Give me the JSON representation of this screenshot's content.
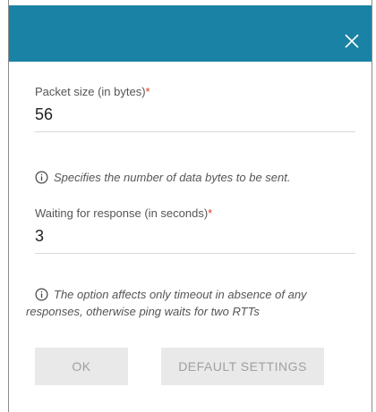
{
  "dialog": {
    "header_color": "#1a82a4",
    "close_icon": "close-icon"
  },
  "fields": {
    "packet_size": {
      "label": "Packet size (in bytes)",
      "required_mark": "*",
      "value": "56",
      "hint": "Specifies the number of data bytes to be sent."
    },
    "waiting": {
      "label": "Waiting for response (in seconds)",
      "required_mark": "*",
      "value": "3",
      "hint_line1": "The option affects only timeout in absence of any",
      "hint_line2": "responses, otherwise ping waits for two RTTs"
    }
  },
  "buttons": {
    "ok_label": "OK",
    "default_settings_label": "DEFAULT SETTINGS"
  },
  "icons": {
    "info": "info-icon"
  }
}
